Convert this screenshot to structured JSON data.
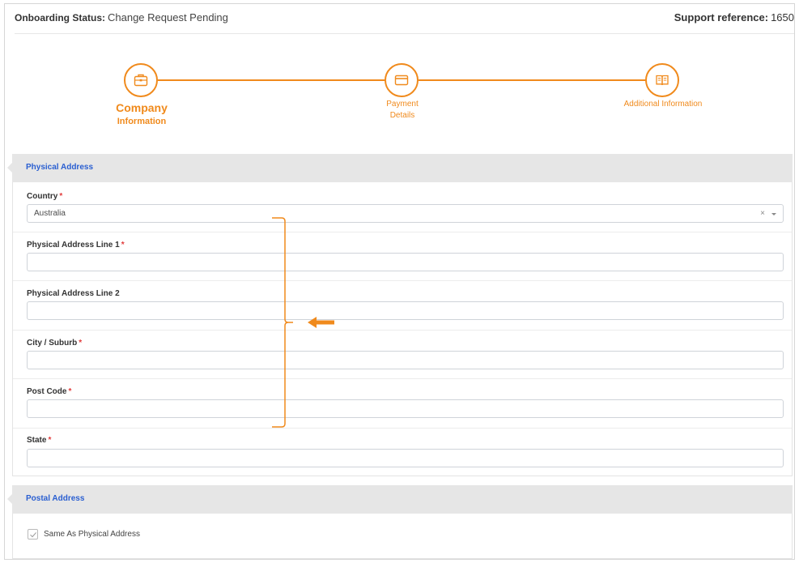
{
  "header": {
    "status_label": "Onboarding Status:",
    "status_value": "Change Request Pending",
    "support_label": "Support reference:",
    "support_value": "1650"
  },
  "steps": [
    {
      "big": "Company",
      "small": "Information",
      "icon": "briefcase-icon",
      "active": true
    },
    {
      "line1": "Payment",
      "line2": "Details",
      "icon": "credit-card-icon",
      "active": false
    },
    {
      "label": "Additional Information",
      "icon": "book-icon",
      "active": false
    }
  ],
  "physical_address": {
    "title": "Physical Address",
    "country": {
      "label": "Country",
      "value": "Australia",
      "clear": "×"
    },
    "line1": {
      "label": "Physical Address Line 1",
      "value": ""
    },
    "line2": {
      "label": "Physical Address Line 2",
      "value": ""
    },
    "city": {
      "label": "City / Suburb",
      "value": ""
    },
    "postcode": {
      "label": "Post Code",
      "value": ""
    },
    "state": {
      "label": "State",
      "value": ""
    },
    "required_mark": "*"
  },
  "postal_address": {
    "title": "Postal Address",
    "same_as_physical": {
      "label": "Same As Physical Address",
      "checked": true
    }
  },
  "colors": {
    "accent": "#f08a1c",
    "section_title": "#2a5fd1",
    "required": "#e23b3b",
    "section_bg": "#e6e6e6"
  }
}
